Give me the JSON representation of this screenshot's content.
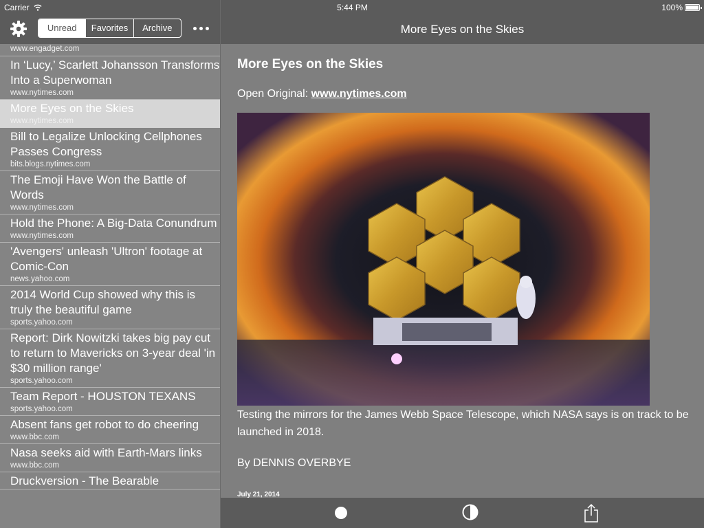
{
  "status": {
    "carrier": "Carrier",
    "time": "5:44 PM",
    "battery": "100%"
  },
  "sidebar": {
    "tabs": [
      "Unread",
      "Favorites",
      "Archive"
    ],
    "items": [
      {
        "title": "",
        "domain": "www.engadget.com"
      },
      {
        "title": "In ‘Lucy,’ Scarlett Johansson Transforms Into a Superwoman",
        "domain": "www.nytimes.com"
      },
      {
        "title": "More Eyes on the Skies",
        "domain": "www.nytimes.com"
      },
      {
        "title": "Bill to Legalize Unlocking Cellphones Passes Congress",
        "domain": "bits.blogs.nytimes.com"
      },
      {
        "title": "The Emoji Have Won the Battle of Words",
        "domain": "www.nytimes.com"
      },
      {
        "title": "Hold the Phone: A Big-Data Conundrum",
        "domain": "www.nytimes.com"
      },
      {
        "title": "'Avengers' unleash 'Ultron' footage at Comic-Con",
        "domain": "news.yahoo.com"
      },
      {
        "title": "2014 World Cup showed why this is truly the beautiful game",
        "domain": "sports.yahoo.com"
      },
      {
        "title": "Report: Dirk Nowitzki takes big pay cut to return to Mavericks on 3-year deal 'in $30 million range'",
        "domain": "sports.yahoo.com"
      },
      {
        "title": "Team Report - HOUSTON TEXANS",
        "domain": "sports.yahoo.com"
      },
      {
        "title": "Absent fans get robot to do cheering",
        "domain": "www.bbc.com"
      },
      {
        "title": "Nasa seeks aid with Earth-Mars links",
        "domain": "www.bbc.com"
      },
      {
        "title": "Druckversion - The Bearable",
        "domain": ""
      }
    ]
  },
  "article": {
    "nav_title": "More Eyes on the Skies",
    "title": "More Eyes on the Skies",
    "open_original_label": "Open Original:",
    "open_original_link": "www.nytimes.com",
    "caption": "Testing the mirrors for the James Webb Space Telescope, which NASA says is on track to be launched in 2018.",
    "byline": "By DENNIS OVERBYE",
    "date": "July 21, 2014"
  },
  "icons": [
    "wifi-icon",
    "gear-icon",
    "more-icon",
    "dot-icon",
    "contrast-icon",
    "share-icon"
  ]
}
